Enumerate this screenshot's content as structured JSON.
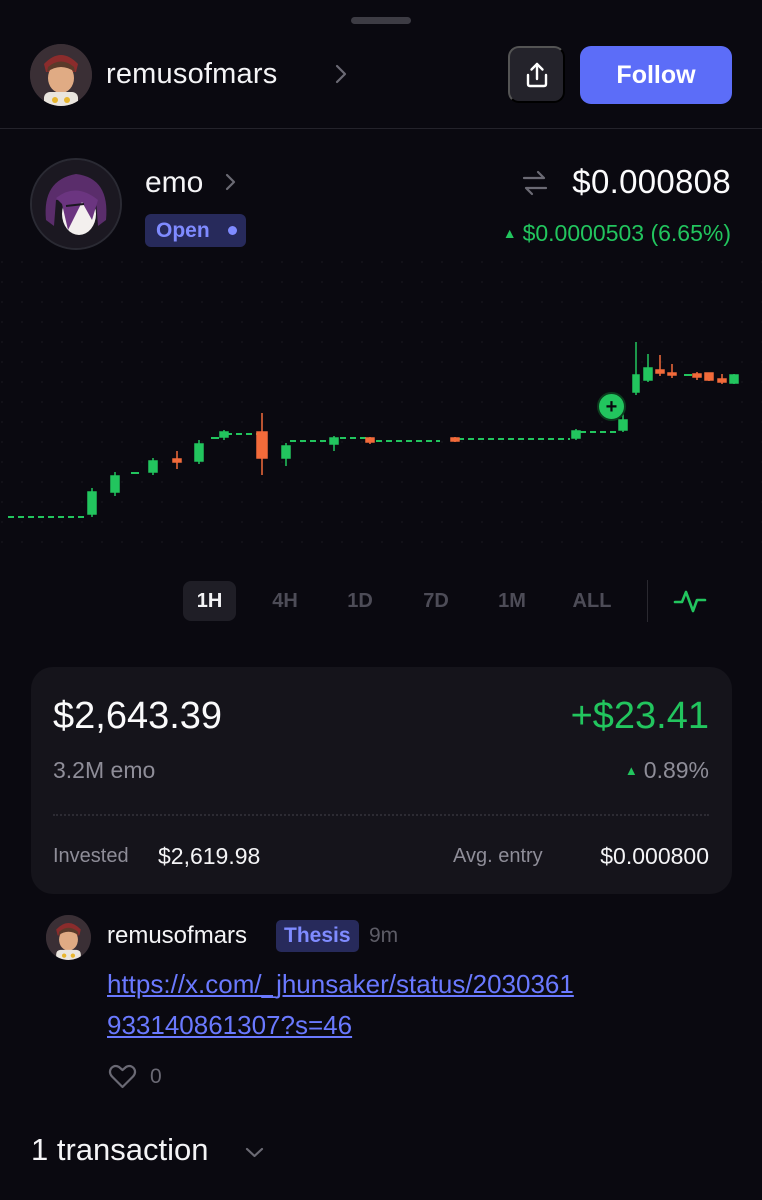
{
  "header": {
    "username": "remusofmars",
    "follow_label": "Follow"
  },
  "token": {
    "name": "emo",
    "status": "Open",
    "price": "$0.000808",
    "change": "$0.0000503 (6.65%)"
  },
  "timeframes": [
    {
      "label": "1H",
      "active": true
    },
    {
      "label": "4H",
      "active": false
    },
    {
      "label": "1D",
      "active": false
    },
    {
      "label": "7D",
      "active": false
    },
    {
      "label": "1M",
      "active": false
    },
    {
      "label": "ALL",
      "active": false
    }
  ],
  "position": {
    "value": "$2,643.39",
    "pnl": "+$23.41",
    "quantity": "3.2M emo",
    "pnl_percent": "0.89%",
    "invested_label": "Invested",
    "invested": "$2,619.98",
    "avg_entry_label": "Avg. entry",
    "avg_entry": "$0.000800"
  },
  "comment": {
    "author": "remusofmars",
    "tag": "Thesis",
    "time": "9m",
    "link": "https://x.com/_jhunsaker/status/2030361933140861307?s=46",
    "likes": "0"
  },
  "transactions": {
    "title": "1 transaction"
  },
  "colors": {
    "background": "#0a0910",
    "accent": "#5c6df8",
    "up": "#22c55e",
    "down": "#f26b3a",
    "tag_bg": "#272a5b",
    "tag_text": "#7f8bff"
  },
  "icons": [
    "share-icon",
    "chevron-right-icon",
    "swap-icon",
    "line-chart-icon",
    "heart-icon",
    "chevron-down-icon"
  ]
}
